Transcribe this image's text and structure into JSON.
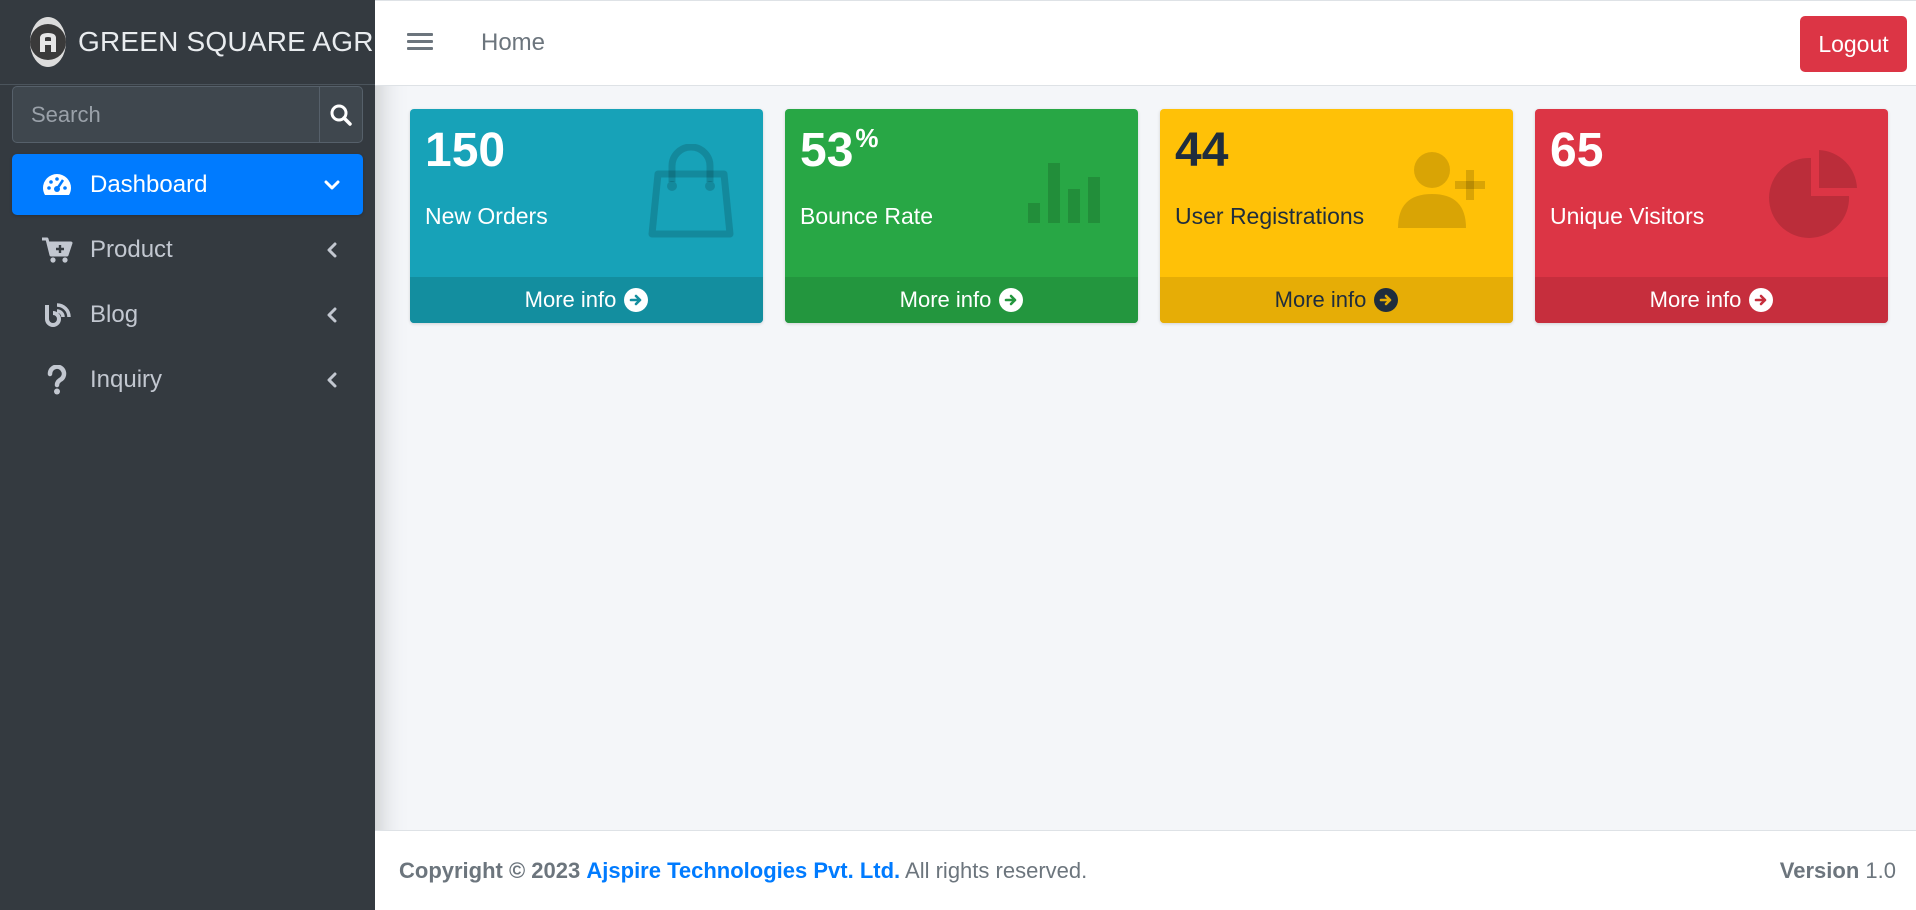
{
  "brand": {
    "name": "GREEN SQUARE AGRO",
    "logo_icon": "brand-logo-icon"
  },
  "search": {
    "placeholder": "Search",
    "value": ""
  },
  "sidebar": {
    "items": [
      {
        "label": "Dashboard",
        "icon": "tachometer-icon",
        "active": true,
        "caret": "chevron-down"
      },
      {
        "label": "Product",
        "icon": "cart-plus-icon",
        "active": false,
        "caret": "chevron-left"
      },
      {
        "label": "Blog",
        "icon": "blog-icon",
        "active": false,
        "caret": "chevron-left"
      },
      {
        "label": "Inquiry",
        "icon": "question-icon",
        "active": false,
        "caret": "chevron-left"
      }
    ]
  },
  "topbar": {
    "home_label": "Home",
    "logout_label": "Logout"
  },
  "cards": [
    {
      "value": "150",
      "suffix": "",
      "label": "New Orders",
      "more": "More info",
      "icon": "shopping-bag-icon",
      "color": "#17a2b8"
    },
    {
      "value": "53",
      "suffix": "%",
      "label": "Bounce Rate",
      "more": "More info",
      "icon": "bar-chart-icon",
      "color": "#28a745"
    },
    {
      "value": "44",
      "suffix": "",
      "label": "User Registrations",
      "more": "More info",
      "icon": "user-plus-icon",
      "color": "#ffc107"
    },
    {
      "value": "65",
      "suffix": "",
      "label": "Unique Visitors",
      "more": "More info",
      "icon": "pie-chart-icon",
      "color": "#dc3545"
    }
  ],
  "footer": {
    "copyright": "Copyright © 2023",
    "company": "Ajspire Technologies Pvt. Ltd.",
    "rights": "All rights reserved.",
    "version_label": "Version",
    "version_value": "1.0"
  }
}
